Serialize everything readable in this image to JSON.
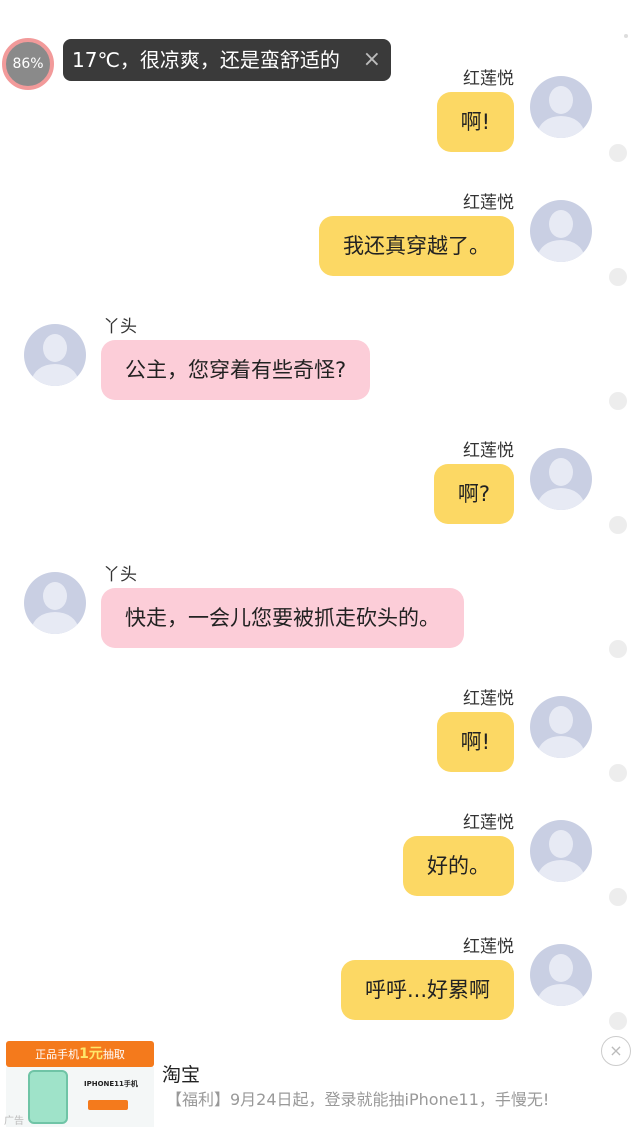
{
  "overlay": {
    "battery_percent": "86%",
    "weather_text": "17℃，很凉爽，还是蛮舒适的",
    "close_glyph": "×"
  },
  "messages": [
    {
      "side": "right",
      "name": "红莲悦",
      "text": "啊!"
    },
    {
      "side": "right",
      "name": "红莲悦",
      "text": "我还真穿越了。"
    },
    {
      "side": "left",
      "name": "丫头",
      "text": "公主，您穿着有些奇怪?"
    },
    {
      "side": "right",
      "name": "红莲悦",
      "text": "啊?"
    },
    {
      "side": "left",
      "name": "丫头",
      "text": "快走，一会儿您要被抓走砍头的。"
    },
    {
      "side": "right",
      "name": "红莲悦",
      "text": "啊!"
    },
    {
      "side": "right",
      "name": "红莲悦",
      "text": "好的。"
    },
    {
      "side": "right",
      "name": "红莲悦",
      "text": "呼呼...好累啊"
    }
  ],
  "ad": {
    "banner_prefix": "正品手机",
    "banner_highlight": "1元",
    "banner_suffix": "抽取",
    "product_text": "IPHONE11手机",
    "mark": "广告",
    "title": "淘宝",
    "description": "【福利】9月24日起，登录就能抽iPhone11，手慢无!",
    "close_glyph": "×"
  },
  "colors": {
    "self_bubble": "#fcd864",
    "other_bubble": "#fccdd8",
    "avatar": "#c9cfe3"
  }
}
